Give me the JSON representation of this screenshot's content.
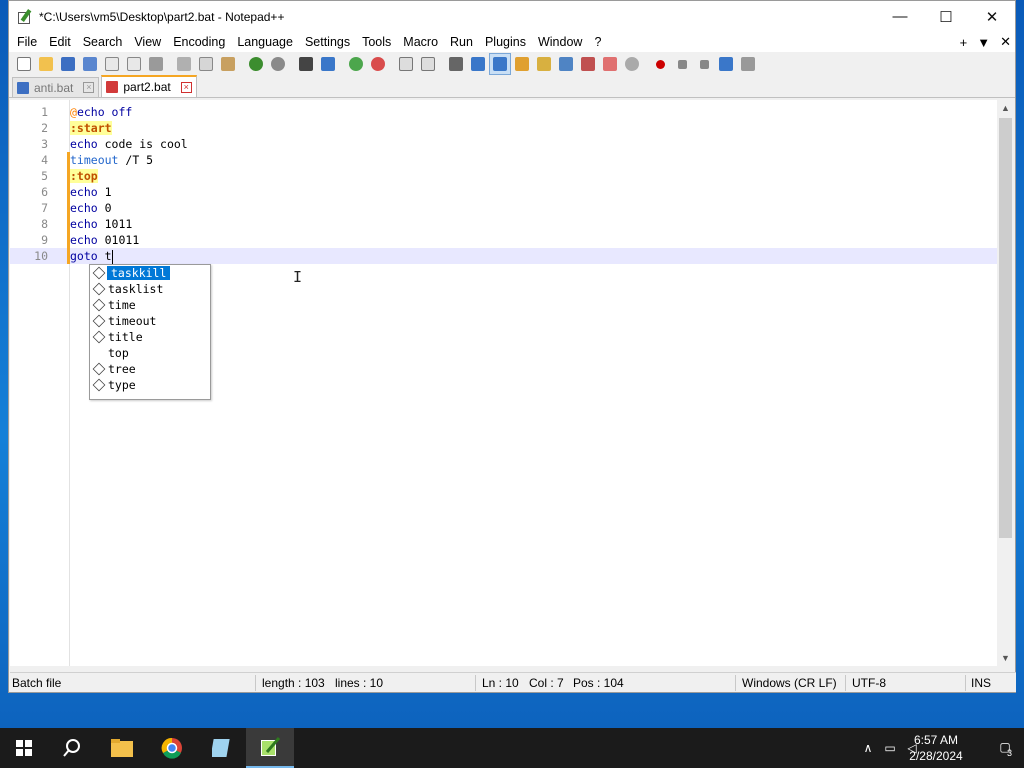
{
  "window": {
    "title": "*C:\\Users\\vm5\\Desktop\\part2.bat - Notepad++",
    "minimize": "—",
    "maximize": "☐",
    "close": "✕"
  },
  "menu": {
    "items": [
      "File",
      "Edit",
      "Search",
      "View",
      "Encoding",
      "Language",
      "Settings",
      "Tools",
      "Macro",
      "Run",
      "Plugins",
      "Window",
      "?"
    ],
    "right_plus": "+",
    "right_down": "▼",
    "right_close": "✕"
  },
  "tabs": [
    {
      "label": "anti.bat",
      "active": false
    },
    {
      "label": "part2.bat",
      "active": true
    }
  ],
  "editor": {
    "lines": [
      {
        "num": "1"
      },
      {
        "num": "2"
      },
      {
        "num": "3"
      },
      {
        "num": "4"
      },
      {
        "num": "5"
      },
      {
        "num": "6"
      },
      {
        "num": "7"
      },
      {
        "num": "8"
      },
      {
        "num": "9"
      },
      {
        "num": "10"
      }
    ],
    "code": {
      "l1_at": "@",
      "l1_rest": "echo off",
      "l2_label": ":start",
      "l3_kw": "echo",
      "l3_rest": " code is cool",
      "l4_kw": "timeout",
      "l4_rest": " /T 5",
      "l5_label": ":top",
      "l6_kw": "echo",
      "l6_rest": " 1",
      "l7_kw": "echo",
      "l7_rest": " 0",
      "l8_kw": "echo",
      "l8_rest": " 1011",
      "l9_kw": "echo",
      "l9_rest": " 01011",
      "l10_kw": "goto",
      "l10_rest": " t"
    }
  },
  "autocomplete": {
    "items": [
      {
        "label": "taskkill",
        "icon": true,
        "selected": true
      },
      {
        "label": "tasklist",
        "icon": true
      },
      {
        "label": "time",
        "icon": true
      },
      {
        "label": "timeout",
        "icon": true
      },
      {
        "label": "title",
        "icon": true
      },
      {
        "label": "top",
        "icon": false
      },
      {
        "label": "tree",
        "icon": true
      },
      {
        "label": "type",
        "icon": true
      }
    ]
  },
  "status": {
    "language": "Batch file",
    "length": "length : 103",
    "lines": "lines : 10",
    "ln": "Ln : 10",
    "col": "Col : 7",
    "pos": "Pos : 104",
    "eol": "Windows (CR LF)",
    "encoding": "UTF-8",
    "mode": "INS"
  },
  "taskbar": {
    "time": "6:57 AM",
    "date": "2/28/2024",
    "notifications": "3"
  },
  "colors": {
    "accent": "#0078d7",
    "tab_active_border": "#f5a623",
    "label_highlight": "#ffff99",
    "current_line": "#e8e8ff"
  }
}
